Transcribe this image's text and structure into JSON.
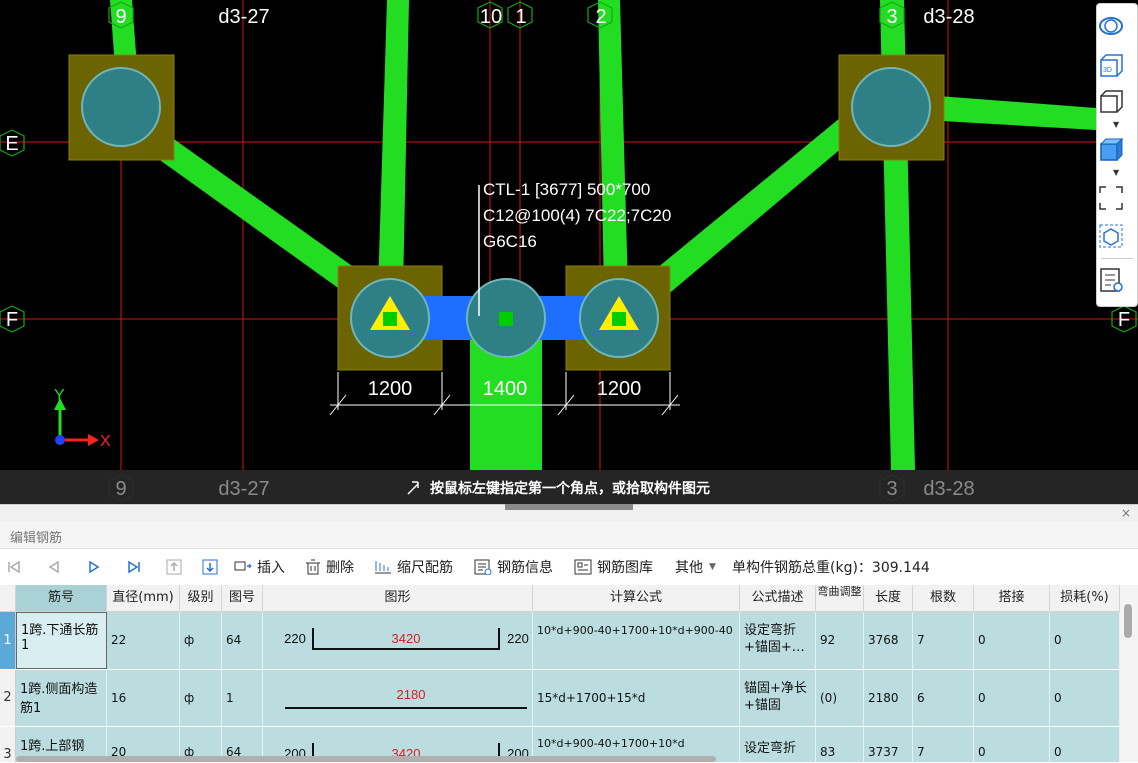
{
  "canvas": {
    "axis_labels_top": [
      "9",
      "d3-27",
      "10",
      "1",
      "2",
      "3",
      "d3-28"
    ],
    "axis_labels_bottom": [
      "9",
      "d3-27",
      "3",
      "d3-28"
    ],
    "axis_labels_left": [
      "E",
      "F"
    ],
    "axis_label_right": "F",
    "annotation": {
      "line1": "CTL-1 [3677] 500*700",
      "line2": "C12@100(4) 7C22;7C20",
      "line3": "G6C16"
    },
    "dimensions": [
      "1200",
      "1400",
      "1200"
    ],
    "coord_x": "X",
    "coord_y": "Y",
    "status_text": "按鼠标左键指定第一个角点，或拾取构件图元",
    "colors": {
      "rebar_green": "#22dd22",
      "beam_blue": "#1e6fff",
      "column_fill": "#2f7f86",
      "pad_fill": "#6b6400",
      "grid_red": "#d41414"
    }
  },
  "view_toolbar": {
    "icons": [
      "orbit-icon",
      "view-3d-icon",
      "cube-wire-icon",
      "cube-solid-icon",
      "fit-view-icon",
      "local-3d-icon",
      "properties-view-icon"
    ]
  },
  "panel": {
    "title": "编辑钢筋",
    "close": "×"
  },
  "toolbar": {
    "insert": "插入",
    "delete": "删除",
    "scale": "缩尺配筋",
    "rebar_info": "钢筋信息",
    "rebar_library": "钢筋图库",
    "other": "其他",
    "total_label": "单构件钢筋总重(kg)：309.144"
  },
  "table": {
    "headers": [
      "筋号",
      "直径(mm)",
      "级别",
      "图号",
      "图形",
      "计算公式",
      "公式描述",
      "弯曲调整",
      "长度",
      "根数",
      "搭接",
      "损耗(%)"
    ],
    "rows": [
      {
        "num": "1",
        "name": "1跨.下通长筋1",
        "dia": "22",
        "grade": "ф",
        "fig": "64",
        "shape_left": "220",
        "shape_mid": "3420",
        "shape_right": "220",
        "formula": "10*d+900-40+1700+10*d+900-40",
        "desc": "设定弯折+锚固+…",
        "bend": "92",
        "length": "3768",
        "count": "7",
        "lap": "0",
        "loss": "0"
      },
      {
        "num": "2",
        "name": "1跨.侧面构造筋1",
        "dia": "16",
        "grade": "ф",
        "fig": "1",
        "shape_left": "",
        "shape_mid": "2180",
        "shape_right": "",
        "formula": "15*d+1700+15*d",
        "desc": "锚固+净长+锚固",
        "bend": "(0)",
        "length": "2180",
        "count": "6",
        "lap": "0",
        "loss": "0"
      },
      {
        "num": "3",
        "name": "1跨.上部钢",
        "dia": "20",
        "grade": "ф",
        "fig": "64",
        "shape_left": "200",
        "shape_mid": "3420",
        "shape_right": "200",
        "formula": "10*d+900-40+1700+10*d",
        "desc": "设定弯折",
        "bend": "83",
        "length": "3737",
        "count": "7",
        "lap": "0",
        "loss": "0"
      }
    ]
  }
}
